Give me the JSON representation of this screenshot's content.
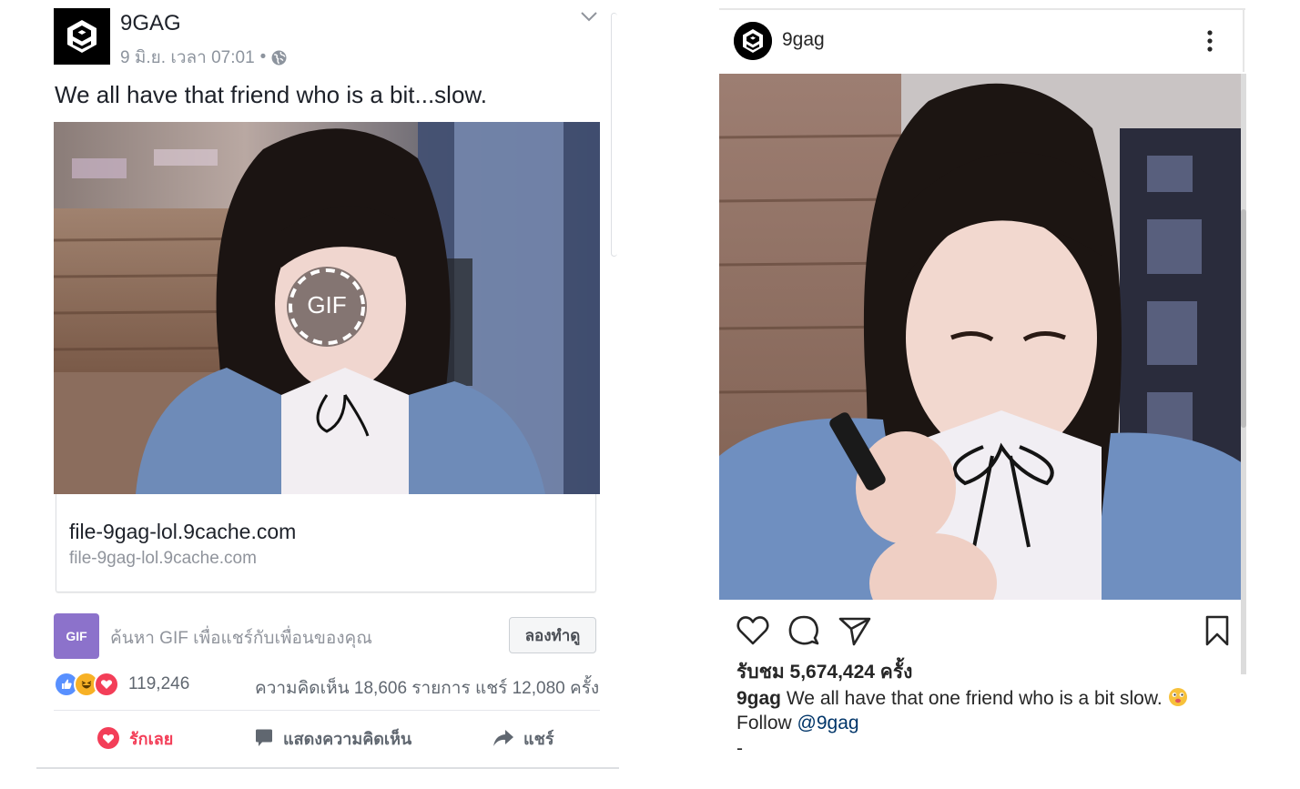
{
  "facebook": {
    "page_name": "9GAG",
    "timestamp": "9 มิ.ย. เวลา 07:01",
    "meta_separator": "•",
    "post_text": "We all have that friend who is a bit...slow.",
    "gif_label": "GIF",
    "link_title": "file-9gag-lol.9cache.com",
    "link_domain": "file-9gag-lol.9cache.com",
    "gif_badge": "GIF",
    "gif_search_placeholder": "ค้นหา GIF เพื่อแชร์กับเพื่อนของคุณ",
    "try_button": "ลองทำดู",
    "reaction_count": "119,246",
    "stats": "ความคิดเห็น 18,606 รายการ แชร์ 12,080 ครั้ง",
    "actions": {
      "love": "รักเลย",
      "comment": "แสดงความคิดเห็น",
      "share": "แชร์"
    },
    "icons": [
      "9gag-logo-icon",
      "globe-icon",
      "chevron-down-icon",
      "like-reaction-icon",
      "haha-reaction-icon",
      "love-reaction-icon",
      "heart-icon",
      "comment-icon",
      "share-icon"
    ],
    "colors": {
      "love": "#f33e58",
      "like": "#5890ff",
      "haha": "#f7b125",
      "gif_badge": "#8c72cb"
    }
  },
  "instagram": {
    "username": "9gag",
    "views": "รับชม 5,674,424 ครั้ง",
    "caption_user": "9gag",
    "caption_text": "We all have that one friend who is a bit slow.",
    "follow_text": "Follow",
    "mention": "@9gag",
    "trailing": "-",
    "icons": [
      "9gag-logo-icon",
      "more-options-icon",
      "heart-icon",
      "comment-icon",
      "direct-share-icon",
      "bookmark-icon",
      "emoji-icon"
    ],
    "colors": {
      "mention": "#003569"
    }
  }
}
